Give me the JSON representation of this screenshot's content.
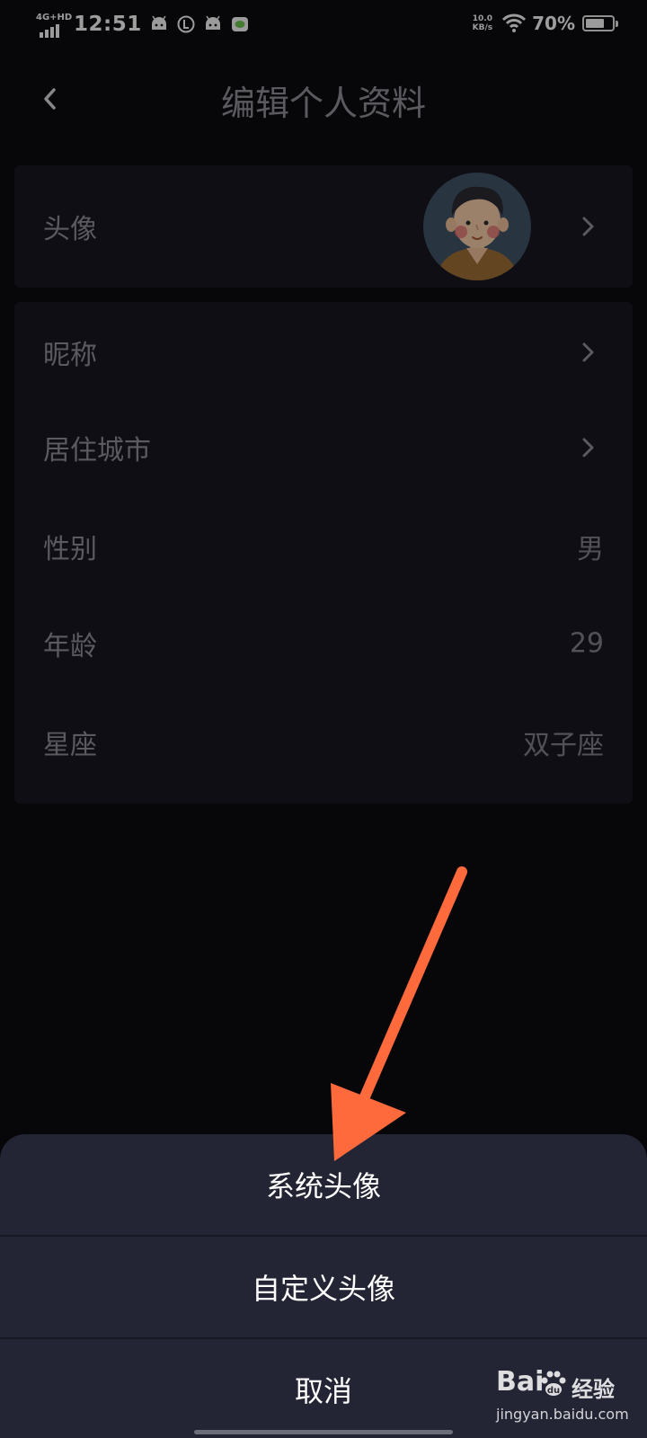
{
  "status_bar": {
    "network": "4G+HD",
    "time": "12:51",
    "speed_value": "10.0",
    "speed_unit": "KB/s",
    "battery_percent": "70%",
    "battery_level": 0.7,
    "notification_icons": [
      "android-icon",
      "data-saver-icon",
      "android-icon",
      "app-notification-icon"
    ]
  },
  "nav": {
    "title": "编辑个人资料",
    "back_icon": "chevron-left-icon"
  },
  "profile": {
    "avatar_row": {
      "label": "头像",
      "avatar": "cartoon-man-avatar",
      "chevron": true
    },
    "rows": [
      {
        "label": "昵称",
        "value": "",
        "chevron": true
      },
      {
        "label": "居住城市",
        "value": "",
        "chevron": true
      },
      {
        "label": "性别",
        "value": "男",
        "chevron": false
      },
      {
        "label": "年龄",
        "value": "29",
        "chevron": false
      },
      {
        "label": "星座",
        "value": "双子座",
        "chevron": false
      }
    ]
  },
  "action_sheet": {
    "options": [
      "系统头像",
      "自定义头像"
    ],
    "cancel": "取消"
  },
  "annotation": {
    "arrow_color": "#ff6a3d"
  },
  "watermark": {
    "brand": "Bai",
    "brand_cn": "经验",
    "url": "jingyan.baidu.com"
  },
  "colors": {
    "background": "#0b0b10",
    "card": "#16161f",
    "sheet": "#232434"
  }
}
